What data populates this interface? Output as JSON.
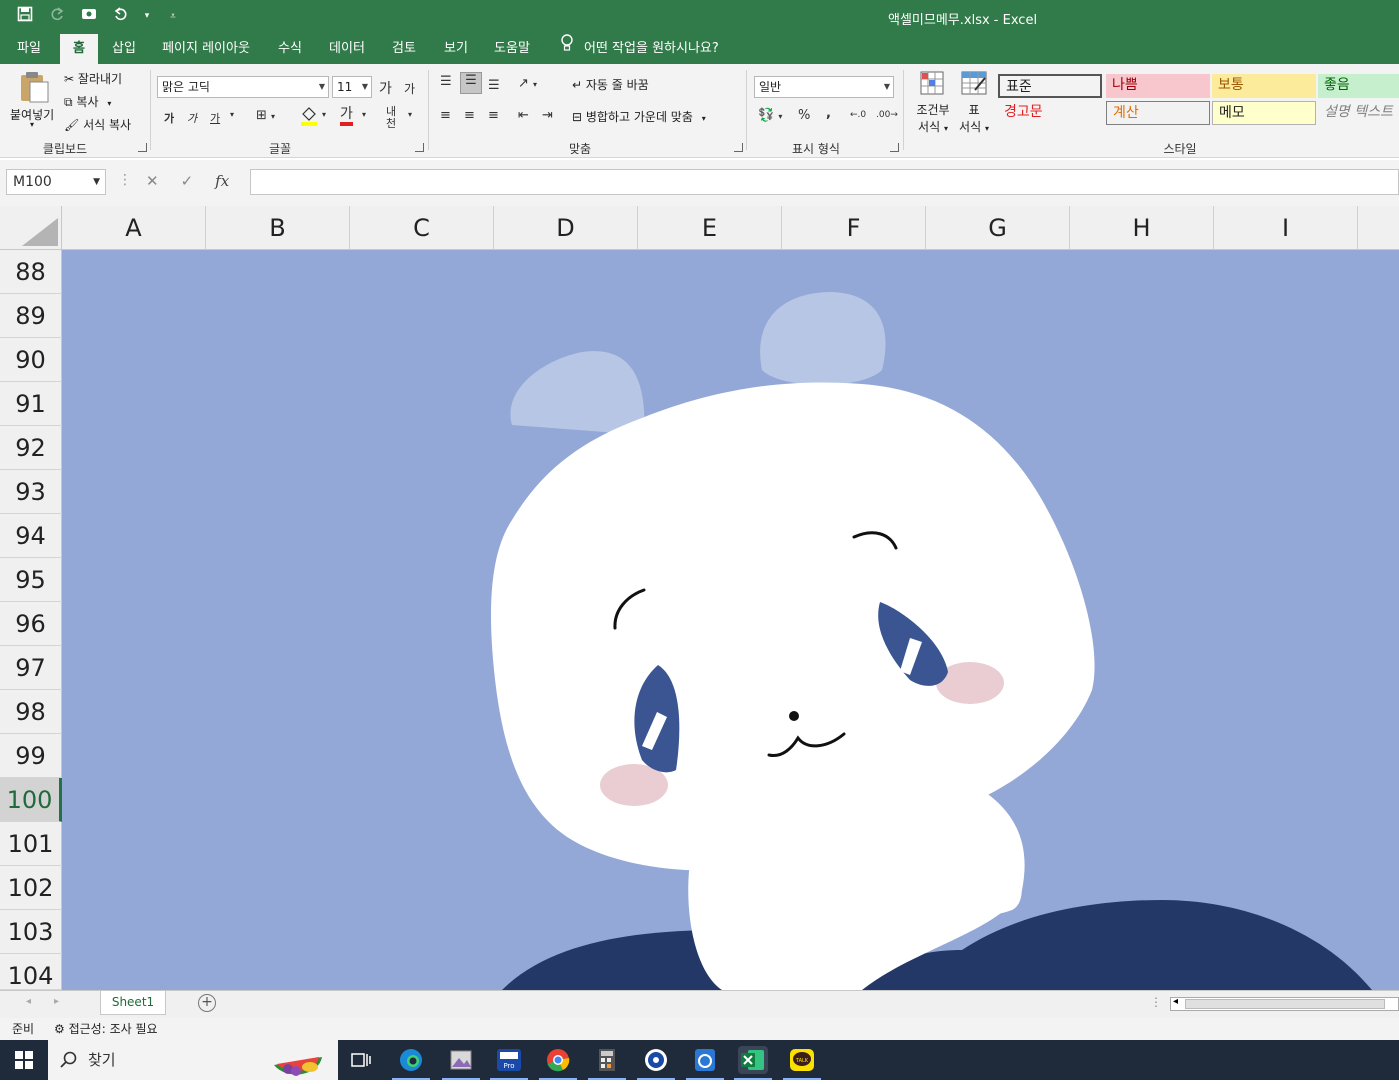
{
  "titlebar": {
    "title": "액셀미므메무.xlsx  -  Excel"
  },
  "tabs": [
    "파일",
    "홈",
    "삽입",
    "페이지 레이아웃",
    "수식",
    "데이터",
    "검토",
    "보기",
    "도움말"
  ],
  "tell_me": "어떤 작업을 원하시나요?",
  "ribbon": {
    "clipboard": {
      "paste": "붙여넣기",
      "cut": "잘라내기",
      "copy": "복사",
      "format_painter": "서식 복사",
      "label": "클립보드"
    },
    "font": {
      "name": "맑은 고딕",
      "size": "11",
      "grow": "가",
      "shrink": "가",
      "bold": "가",
      "italic": "가",
      "underline": "가",
      "font_color_glyph": "가",
      "phonetic": "내천",
      "label": "글꼴"
    },
    "alignment": {
      "wrap": "자동 줄 바꿈",
      "merge": "병합하고 가운데 맞춤",
      "label": "맞춤"
    },
    "number": {
      "format": "일반",
      "percent": "%",
      "comma": ",",
      "label": "표시 형식"
    },
    "styles": {
      "conditional": [
        "조건부",
        "서식"
      ],
      "table": [
        "표",
        "서식"
      ],
      "cells": [
        {
          "name": "표준",
          "bg": "#ffffff",
          "fg": "#000000"
        },
        {
          "name": "나쁨",
          "bg": "#f8c7ce",
          "fg": "#9c0006"
        },
        {
          "name": "보통",
          "bg": "#fdeb9c",
          "fg": "#9c5700"
        },
        {
          "name": "좋음",
          "bg": "#c6efce",
          "fg": "#006100"
        },
        {
          "name": "경고문",
          "bg": "#ffffff",
          "fg": "#e02020"
        },
        {
          "name": "계산",
          "bg": "#f2f2f2",
          "fg": "#e07000"
        },
        {
          "name": "메모",
          "bg": "#ffffcc",
          "fg": "#000000"
        },
        {
          "name": "설명 텍스트",
          "bg": "#ffffff",
          "fg": "#7f7f7f"
        }
      ],
      "label": "스타일"
    }
  },
  "formula_bar": {
    "name_box": "M100",
    "cancel": "✕",
    "enter": "✓",
    "fx": "fx",
    "value": ""
  },
  "columns": [
    "A",
    "B",
    "C",
    "D",
    "E",
    "F",
    "G",
    "H",
    "I"
  ],
  "rows": [
    "88",
    "89",
    "90",
    "91",
    "92",
    "93",
    "94",
    "95",
    "96",
    "97",
    "98",
    "99",
    "100",
    "101",
    "102",
    "103",
    "104"
  ],
  "selected_row": "100",
  "sheet_tabs": [
    "Sheet1"
  ],
  "status": {
    "ready": "준비",
    "accessibility": "접근성: 조사 필요"
  },
  "taskbar": {
    "search": "찾기"
  },
  "colors": {
    "excel_green": "#317a49",
    "canvas_bg": "#94a8d7",
    "character_white": "#ffffff",
    "ear": "#b6c6e4",
    "eye": "#3a5591",
    "blush": "#e9cdd2",
    "body_dark": "#243867"
  }
}
